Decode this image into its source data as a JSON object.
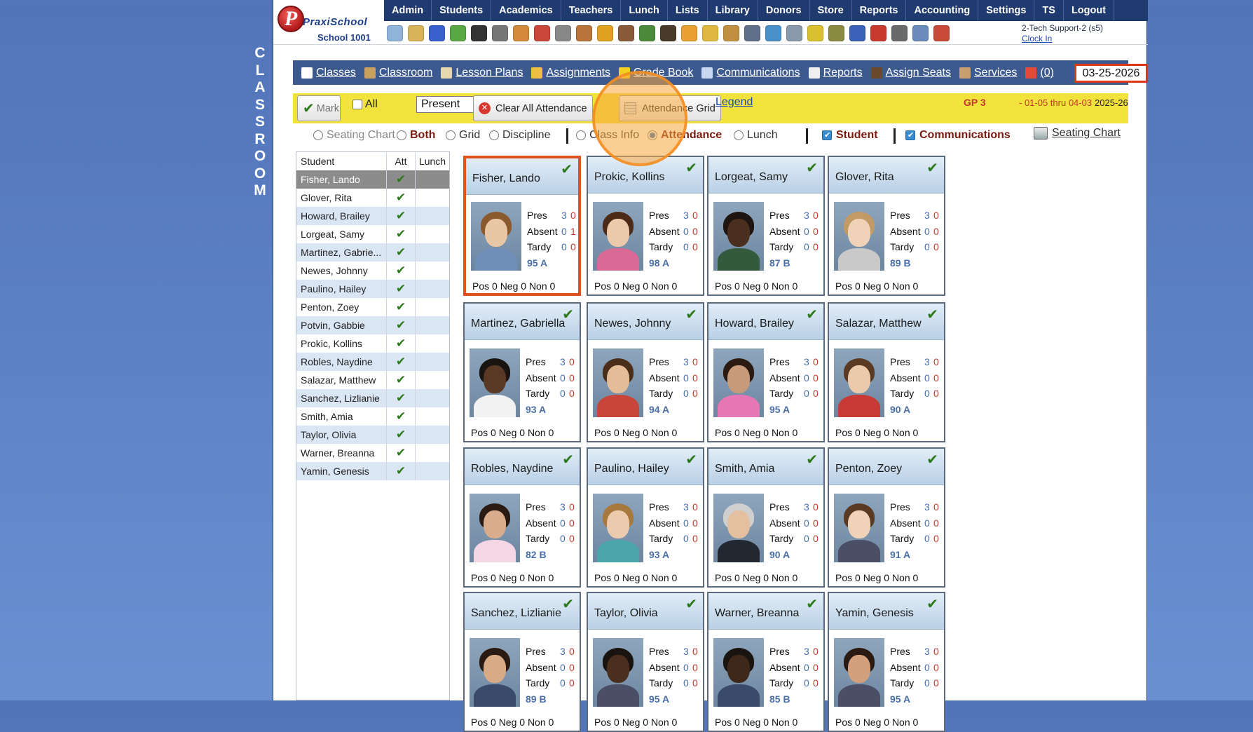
{
  "side_word": [
    "C",
    "L",
    "A",
    "S",
    "S",
    "R",
    "O",
    "O",
    "M"
  ],
  "logo": {
    "brand": "PraxiSchool",
    "school": "School 1001"
  },
  "topnav": [
    "Admin",
    "Students",
    "Academics",
    "Teachers",
    "Lunch",
    "Lists",
    "Library",
    "Donors",
    "Store",
    "Reports",
    "Accounting",
    "Settings",
    "TS",
    "Logout"
  ],
  "user": {
    "name": "2-Tech Support-2 (s5)",
    "clock_in": "Clock In"
  },
  "classbar": {
    "items": [
      {
        "label": "Classes",
        "icon": "pointer-icon"
      },
      {
        "label": "Classroom",
        "icon": "classroom-icon"
      },
      {
        "label": "Lesson Plans",
        "icon": "book-icon"
      },
      {
        "label": "Assignments",
        "icon": "assignments-chart-icon"
      },
      {
        "label": "Grade Book",
        "icon": "a-plus-icon"
      },
      {
        "label": "Communications",
        "icon": "communications-icon"
      },
      {
        "label": "Reports",
        "icon": "report-icon"
      },
      {
        "label": "Assign Seats",
        "icon": "seat-icon"
      },
      {
        "label": "Services",
        "icon": "services-icon"
      },
      {
        "label": "(0)",
        "icon": "message-icon"
      }
    ],
    "date": "03-25-2026"
  },
  "attbar": {
    "mark_label": "Mark",
    "all_label": "All",
    "select_value": "Present",
    "clear_label": "Clear All Attendance",
    "grid_label": "Attendance Grid",
    "legend_label": "Legend",
    "gp": "GP 3",
    "gp_range": "- 01-05 thru 04-03",
    "year": "2025-26"
  },
  "options": {
    "seating_chart": "Seating Chart",
    "both": "Both",
    "grid": "Grid",
    "discipline": "Discipline",
    "class_info": "Class Info",
    "attendance": "Attendance",
    "lunch": "Lunch",
    "student": "Student",
    "communications": "Communications",
    "seating_chart_link": "Seating Chart"
  },
  "student_list": {
    "headers": [
      "Student",
      "Att",
      "Lunch"
    ],
    "rows": [
      "Fisher, Lando",
      "Glover, Rita",
      "Howard, Brailey",
      "Lorgeat, Samy",
      "Martinez, Gabrie...",
      "Newes, Johnny",
      "Paulino, Hailey",
      "Penton, Zoey",
      "Potvin, Gabbie",
      "Prokic, Kollins",
      "Robles, Naydine",
      "Salazar, Matthew",
      "Sanchez, Lizlianie",
      "Smith, Amia",
      "Taylor, Olivia",
      "Warner, Breanna",
      "Yamin, Genesis"
    ],
    "check_mark": "✔"
  },
  "card_labels": {
    "pres": "Pres",
    "absent": "Absent",
    "tardy": "Tardy",
    "check": "✔"
  },
  "cards": [
    {
      "name": "Fisher, Lando",
      "pres": [
        "3",
        "0"
      ],
      "absent": [
        "0",
        "1"
      ],
      "tardy": [
        "0",
        "0"
      ],
      "grade": "95 A",
      "foot": "Pos 0 Neg 0 Non 0",
      "skin": "#e8c6a6",
      "hair": "#8a5a2c",
      "shirt": "#6f8fb8"
    },
    {
      "name": "Prokic, Kollins",
      "pres": [
        "3",
        "0"
      ],
      "absent": [
        "0",
        "0"
      ],
      "tardy": [
        "0",
        "0"
      ],
      "grade": "98 A",
      "foot": "Pos 0 Neg 0 Non 0",
      "skin": "#ecc9aa",
      "hair": "#4b2a18",
      "shirt": "#d96a96"
    },
    {
      "name": "Lorgeat, Samy",
      "pres": [
        "3",
        "0"
      ],
      "absent": [
        "0",
        "0"
      ],
      "tardy": [
        "0",
        "0"
      ],
      "grade": "87 B",
      "foot": "Pos 0 Neg 0 Non 0",
      "skin": "#4a2e1e",
      "hair": "#1e1410",
      "shirt": "#345a3e"
    },
    {
      "name": "Glover, Rita",
      "pres": [
        "3",
        "0"
      ],
      "absent": [
        "0",
        "0"
      ],
      "tardy": [
        "0",
        "0"
      ],
      "grade": "89 B",
      "foot": "Pos 0 Neg 0 Non 0",
      "skin": "#f0d2b8",
      "hair": "#c29a66",
      "shirt": "#c9c9c9"
    },
    {
      "name": "Martinez, Gabriella",
      "pres": [
        "3",
        "0"
      ],
      "absent": [
        "0",
        "0"
      ],
      "tardy": [
        "0",
        "0"
      ],
      "grade": "93 A",
      "foot": "Pos 0 Neg 0 Non 0",
      "skin": "#5a3826",
      "hair": "#1a1410",
      "shirt": "#f2f2f2"
    },
    {
      "name": "Newes, Johnny",
      "pres": [
        "3",
        "0"
      ],
      "absent": [
        "0",
        "0"
      ],
      "tardy": [
        "0",
        "0"
      ],
      "grade": "94 A",
      "foot": "Pos 0 Neg 0 Non 0",
      "skin": "#e4bc98",
      "hair": "#4a2e1a",
      "shirt": "#c8453a"
    },
    {
      "name": "Howard, Brailey",
      "pres": [
        "3",
        "0"
      ],
      "absent": [
        "0",
        "0"
      ],
      "tardy": [
        "0",
        "0"
      ],
      "grade": "95 A",
      "foot": "Pos 0 Neg 0 Non 0",
      "skin": "#c79a7a",
      "hair": "#2a1a12",
      "shirt": "#e676b4"
    },
    {
      "name": "Salazar, Matthew",
      "pres": [
        "3",
        "0"
      ],
      "absent": [
        "0",
        "0"
      ],
      "tardy": [
        "0",
        "0"
      ],
      "grade": "90 A",
      "foot": "Pos 0 Neg 0 Non 0",
      "skin": "#ecc9aa",
      "hair": "#5a3a22",
      "shirt": "#c83a36"
    },
    {
      "name": "Robles, Naydine",
      "pres": [
        "3",
        "0"
      ],
      "absent": [
        "0",
        "0"
      ],
      "tardy": [
        "0",
        "0"
      ],
      "grade": "82 B",
      "foot": "Pos 0 Neg 0 Non 0",
      "skin": "#d9ad8c",
      "hair": "#2a1a12",
      "shirt": "#f4d6e4"
    },
    {
      "name": "Paulino, Hailey",
      "pres": [
        "3",
        "0"
      ],
      "absent": [
        "0",
        "0"
      ],
      "tardy": [
        "0",
        "0"
      ],
      "grade": "93 A",
      "foot": "Pos 0 Neg 0 Non 0",
      "skin": "#eccaae",
      "hair": "#a8793e",
      "shirt": "#4aa6a8"
    },
    {
      "name": "Smith, Amia",
      "pres": [
        "3",
        "0"
      ],
      "absent": [
        "0",
        "0"
      ],
      "tardy": [
        "0",
        "0"
      ],
      "grade": "90 A",
      "foot": "Pos 0 Neg 0 Non 0",
      "skin": "#e4c0a0",
      "hair": "#cfcfcf",
      "shirt": "#222832"
    },
    {
      "name": "Penton, Zoey",
      "pres": [
        "3",
        "0"
      ],
      "absent": [
        "0",
        "0"
      ],
      "tardy": [
        "0",
        "0"
      ],
      "grade": "91 A",
      "foot": "Pos 0 Neg 0 Non 0",
      "skin": "#f0d2b8",
      "hair": "#5a3a22",
      "shirt": "#4a4e66"
    },
    {
      "name": "Sanchez, Lizlianie",
      "pres": [
        "3",
        "0"
      ],
      "absent": [
        "0",
        "0"
      ],
      "tardy": [
        "0",
        "0"
      ],
      "grade": "89 B",
      "foot": "Pos 0 Neg 0 Non 0",
      "skin": "#d8aa86",
      "hair": "#2a1a12",
      "shirt": "#3a4a6a"
    },
    {
      "name": "Taylor, Olivia",
      "pres": [
        "3",
        "0"
      ],
      "absent": [
        "0",
        "0"
      ],
      "tardy": [
        "0",
        "0"
      ],
      "grade": "95 A",
      "foot": "Pos 0 Neg 0 Non 0",
      "skin": "#4a2e1e",
      "hair": "#1a1410",
      "shirt": "#4a4e66"
    },
    {
      "name": "Warner, Breanna",
      "pres": [
        "3",
        "0"
      ],
      "absent": [
        "0",
        "0"
      ],
      "tardy": [
        "0",
        "0"
      ],
      "grade": "85 B",
      "foot": "Pos 0 Neg 0 Non 0",
      "skin": "#3e281a",
      "hair": "#1a1410",
      "shirt": "#3a4a6a"
    },
    {
      "name": "Yamin, Genesis",
      "pres": [
        "3",
        "0"
      ],
      "absent": [
        "0",
        "0"
      ],
      "tardy": [
        "0",
        "0"
      ],
      "grade": "95 A",
      "foot": "Pos 0 Neg 0 Non 0",
      "skin": "#d2a07c",
      "hair": "#2a1a12",
      "shirt": "#4a4e66"
    }
  ],
  "selected_card": 0,
  "colors": {
    "nav_bg": "#1f3a6e",
    "classbar_bg": "#3d5a8f",
    "attbar_bg": "#f2e23c",
    "selected_border": "#e0521d",
    "check_green": "#2d7a1c"
  }
}
